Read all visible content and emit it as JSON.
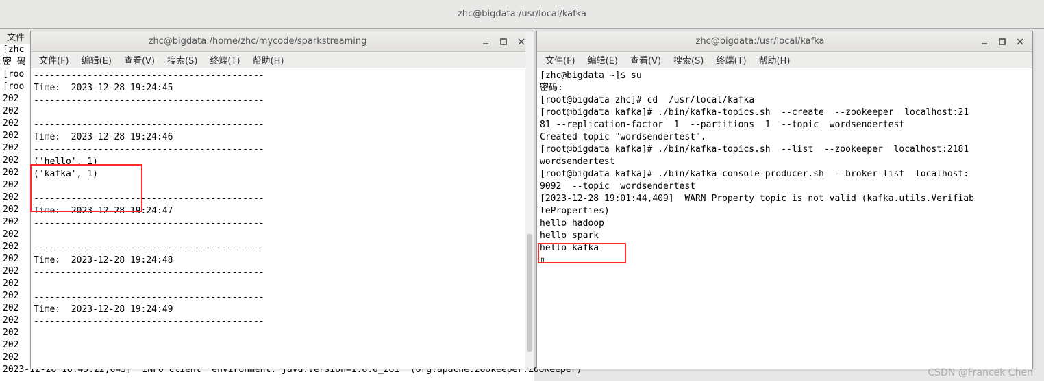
{
  "top_title": "zhc@bigdata:/usr/local/kafka",
  "bg_menu": "文件",
  "bg_terminal_lines": "[zhc\n密 码\n[roo\n[roo\n202\n202\n202\n202\n202\n202\n202\n202\n202\n202\n202\n202\n202\n202\n202\n202\n202\n202\n202\n202\n202\n202\n2023-12-28 18:45:22,643]  INFO Client  environment: java.version=1.8.0_281  (org.apache.zookeeper.ZooKeeper)",
  "menus": {
    "file": "文件(F)",
    "edit": "编辑(E)",
    "view": "查看(V)",
    "search": "搜索(S)",
    "terminal": "终端(T)",
    "help": "帮助(H)"
  },
  "window_left": {
    "title": "zhc@bigdata:/home/zhc/mycode/sparkstreaming",
    "content": "-------------------------------------------\nTime:  2023-12-28 19:24:45\n-------------------------------------------\n\n-------------------------------------------\nTime:  2023-12-28 19:24:46\n-------------------------------------------\n('hello', 1)\n('kafka', 1)\n\n-------------------------------------------\nTime:  2023-12-28 19:24:47\n-------------------------------------------\n\n-------------------------------------------\nTime:  2023-12-28 19:24:48\n-------------------------------------------\n\n-------------------------------------------\nTime:  2023-12-28 19:24:49\n-------------------------------------------\n"
  },
  "window_right": {
    "title": "zhc@bigdata:/usr/local/kafka",
    "content": "[zhc@bigdata ~]$ su\n密码:\n[root@bigdata zhc]# cd  /usr/local/kafka\n[root@bigdata kafka]# ./bin/kafka-topics.sh  --create  --zookeeper  localhost:21\n81 --replication-factor  1  --partitions  1  --topic  wordsendertest\nCreated topic \"wordsendertest\".\n[root@bigdata kafka]# ./bin/kafka-topics.sh  --list  --zookeeper  localhost:2181\nwordsendertest\n[root@bigdata kafka]# ./bin/kafka-console-producer.sh  --broker-list  localhost:\n9092  --topic  wordsendertest\n[2023-12-28 19:01:44,409]  WARN Property topic is not valid (kafka.utils.Verifiab\nleProperties)\nhello hadoop\nhello spark\nhello kafka\n▯"
  },
  "watermark": "CSDN @Francek Chen"
}
